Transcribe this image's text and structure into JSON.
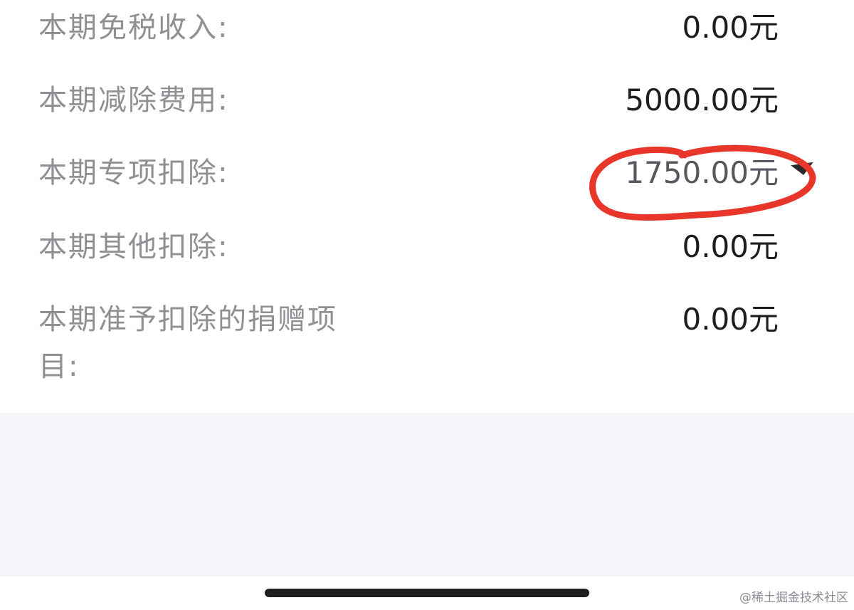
{
  "rows": [
    {
      "label": "本期免税收入:",
      "value": "0.00元"
    },
    {
      "label": "本期减除费用:",
      "value": "5000.00元"
    },
    {
      "label": "本期专项扣除:",
      "value": "1750.00元"
    },
    {
      "label": "本期其他扣除:",
      "value": "0.00元"
    },
    {
      "label": "本期准予扣除的捐赠项目:",
      "value": "0.00元"
    }
  ],
  "annotation": {
    "color": "#e8362a",
    "highlighted_row": "本期专项扣除:"
  },
  "watermark": "@稀土掘金技术社区",
  "colors": {
    "label": "#8f8f94",
    "value": "#1d1d1f",
    "background_gray": "#f5f6fa"
  }
}
